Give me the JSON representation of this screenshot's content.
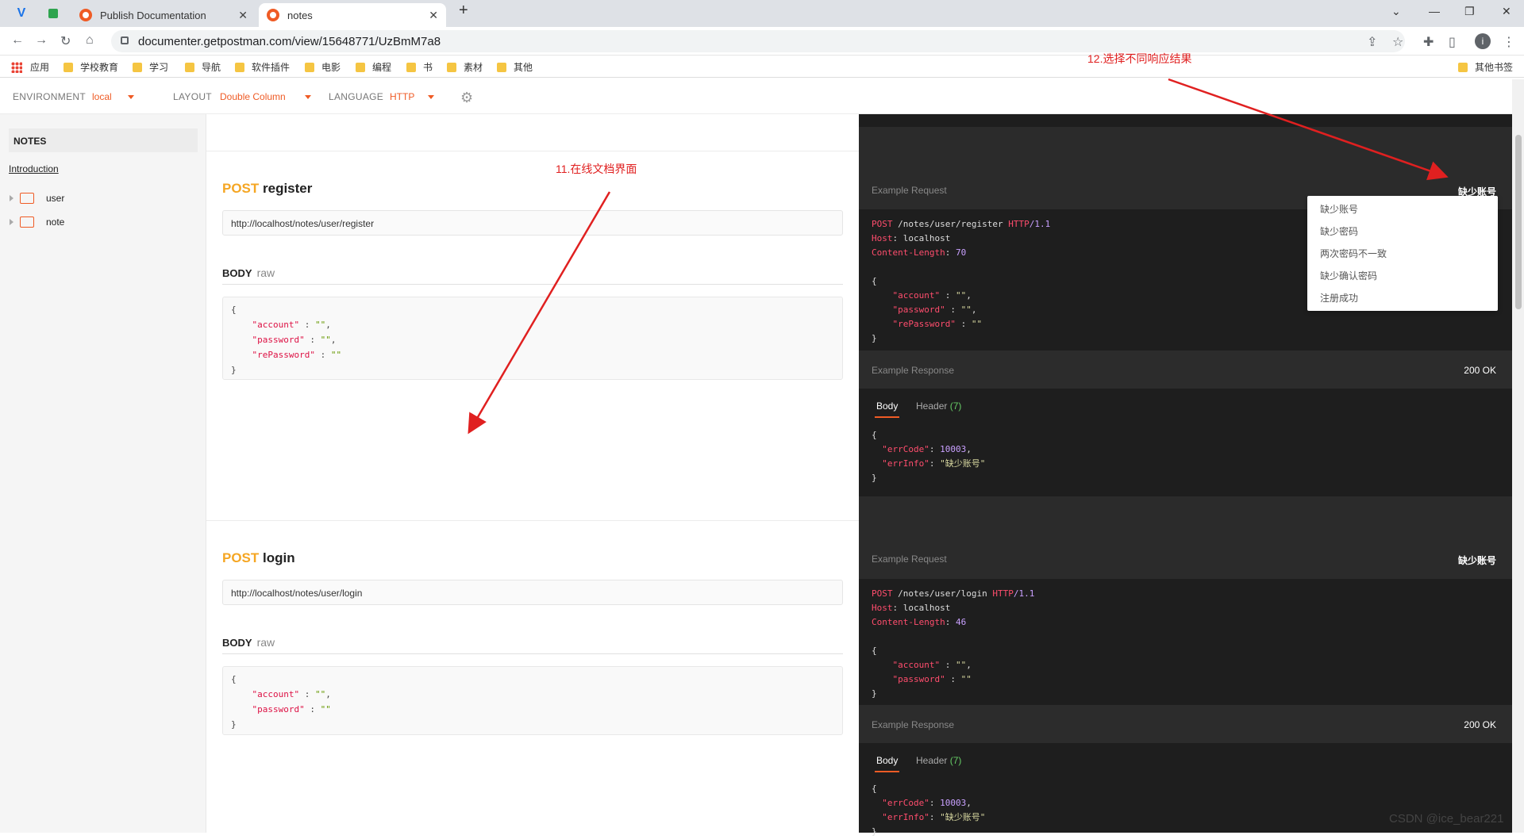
{
  "browser": {
    "tabs": [
      {
        "label": "Publish Documentation"
      },
      {
        "label": "notes"
      }
    ],
    "url": "documenter.getpostman.com/view/15648771/UzBmM7a8",
    "bookmarks": [
      "应用",
      "学校教育",
      "学习",
      "导航",
      "软件插件",
      "电影",
      "编程",
      "书",
      "素材",
      "其他"
    ],
    "bookmarks_right": "其他书签",
    "profile_initial": "i"
  },
  "toolbar": {
    "env_label": "ENVIRONMENT",
    "env_value": "local",
    "layout_label": "LAYOUT",
    "layout_value": "Double Column",
    "lang_label": "LANGUAGE",
    "lang_value": "HTTP"
  },
  "sidebar": {
    "header": "NOTES",
    "intro": "Introduction",
    "folders": [
      "user",
      "note"
    ]
  },
  "main": {
    "endpoints": [
      {
        "method": "POST",
        "name": "register",
        "url": "http://localhost/notes/user/register",
        "body_label": "BODY",
        "body_mode": "raw",
        "body_lines": [
          {
            "key": "\"account\"",
            "val": "\"\""
          },
          {
            "key": "\"password\"",
            "val": "\"\""
          },
          {
            "key": "\"rePassword\"",
            "val": "\"\""
          }
        ]
      },
      {
        "method": "POST",
        "name": "login",
        "url": "http://localhost/notes/user/login",
        "body_label": "BODY",
        "body_mode": "raw",
        "body_lines": [
          {
            "key": "\"account\"",
            "val": "\"\""
          },
          {
            "key": "\"password\"",
            "val": "\"\""
          }
        ]
      }
    ]
  },
  "right": {
    "req_label": "Example Request",
    "resp_label": "Example Response",
    "selected_example": "缺少账号",
    "status": "200 OK",
    "tab_body": "Body",
    "tab_header": "Header",
    "header_count": "(7)",
    "examples": [
      "缺少账号",
      "缺少密码",
      "两次密码不一致",
      "缺少确认密码",
      "注册成功"
    ],
    "req1": {
      "path": "/notes/user/register",
      "proto": "HTTP",
      "ver": "/1.1",
      "host": "localhost",
      "length": "70"
    },
    "req2": {
      "path": "/notes/user/login",
      "proto": "HTTP",
      "ver": "/1.1",
      "host": "localhost",
      "length": "46"
    },
    "resp": {
      "errCode": "10003",
      "errInfo": "\"缺少账号\""
    }
  },
  "annotations": {
    "a11": "11.在线文档界面",
    "a12": "12.选择不同响应结果"
  },
  "watermark": "CSDN @ice_bear221"
}
